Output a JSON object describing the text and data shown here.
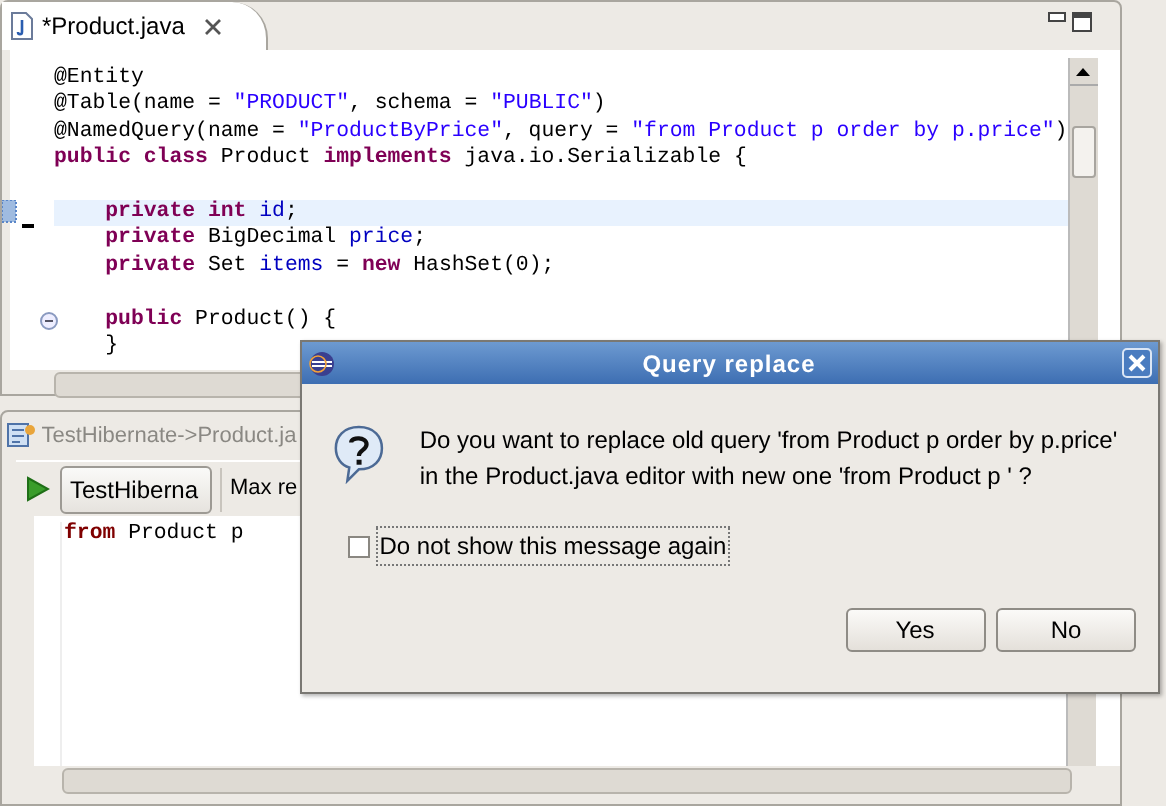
{
  "editor": {
    "tab": {
      "label": "*Product.java",
      "selected": true
    },
    "lines": [
      {
        "current": false,
        "fold": false,
        "indented": false,
        "gap_before": false,
        "tokens": [
          {
            "kind": "plain",
            "text": "@Entity"
          }
        ]
      },
      {
        "current": false,
        "fold": false,
        "indented": false,
        "gap_before": false,
        "tokens": [
          {
            "kind": "plain",
            "text": "@Table(name = "
          },
          {
            "kind": "string",
            "text": "\"PRODUCT\""
          },
          {
            "kind": "plain",
            "text": ", schema = "
          },
          {
            "kind": "string",
            "text": "\"PUBLIC\""
          },
          {
            "kind": "plain",
            "text": ")"
          }
        ]
      },
      {
        "current": false,
        "fold": false,
        "indented": false,
        "gap_before": false,
        "tokens": [
          {
            "kind": "plain",
            "text": "@NamedQuery(name = "
          },
          {
            "kind": "string",
            "text": "\"ProductByPrice\""
          },
          {
            "kind": "plain",
            "text": ", query = "
          },
          {
            "kind": "string",
            "text": "\"from Product p order by p.price\""
          },
          {
            "kind": "plain",
            "text": ")"
          }
        ]
      },
      {
        "current": false,
        "fold": false,
        "indented": false,
        "gap_before": false,
        "tokens": [
          {
            "kind": "keyword",
            "text": "public"
          },
          {
            "kind": "keyword",
            "text": " class"
          },
          {
            "kind": "plain",
            "text": " Product "
          },
          {
            "kind": "keyword",
            "text": "implements"
          },
          {
            "kind": "plain",
            "text": " java.io.Serializable {"
          }
        ]
      },
      {
        "current": true,
        "fold": false,
        "indented": true,
        "gap_before": true,
        "tokens": [
          {
            "kind": "keyword",
            "text": "private"
          },
          {
            "kind": "keyword",
            "text": " int"
          },
          {
            "kind": "field",
            "text": " id"
          },
          {
            "kind": "plain",
            "text": ";"
          }
        ]
      },
      {
        "current": false,
        "fold": false,
        "indented": true,
        "gap_before": false,
        "tokens": [
          {
            "kind": "keyword",
            "text": "private"
          },
          {
            "kind": "plain",
            "text": " BigDecimal "
          },
          {
            "kind": "field",
            "text": "price"
          },
          {
            "kind": "plain",
            "text": ";"
          }
        ]
      },
      {
        "current": false,
        "fold": false,
        "indented": true,
        "gap_before": false,
        "tokens": [
          {
            "kind": "keyword",
            "text": "private"
          },
          {
            "kind": "plain",
            "text": " Set "
          },
          {
            "kind": "field",
            "text": "items"
          },
          {
            "kind": "plain",
            "text": " = "
          },
          {
            "kind": "keyword",
            "text": "new"
          },
          {
            "kind": "plain",
            "text": " HashSet(0);"
          }
        ]
      },
      {
        "current": false,
        "fold": true,
        "indented": true,
        "gap_before": true,
        "tokens": [
          {
            "kind": "keyword",
            "text": "public"
          },
          {
            "kind": "plain",
            "text": " Product() {"
          }
        ]
      },
      {
        "current": false,
        "fold": false,
        "indented": true,
        "gap_before": false,
        "tokens": [
          {
            "kind": "plain",
            "text": "}"
          }
        ]
      }
    ]
  },
  "query_editor": {
    "tab": {
      "label": "TestHibernate->Product.ja",
      "selected": false
    },
    "configuration": "TestHiberna",
    "max_results_label": "Max re",
    "lines": [
      [
        {
          "kind": "hql_keyword",
          "text": "from"
        },
        {
          "kind": "plain",
          "text": " Product p"
        }
      ]
    ]
  },
  "dialog": {
    "title": "Query replace",
    "message": "Do you want to replace old query 'from Product p order by p.price' in the Product.java editor with new one 'from Product p ' ?",
    "checkbox": {
      "label": "Do not show this message again",
      "checked": false
    },
    "buttons": [
      "Yes",
      "No"
    ]
  }
}
